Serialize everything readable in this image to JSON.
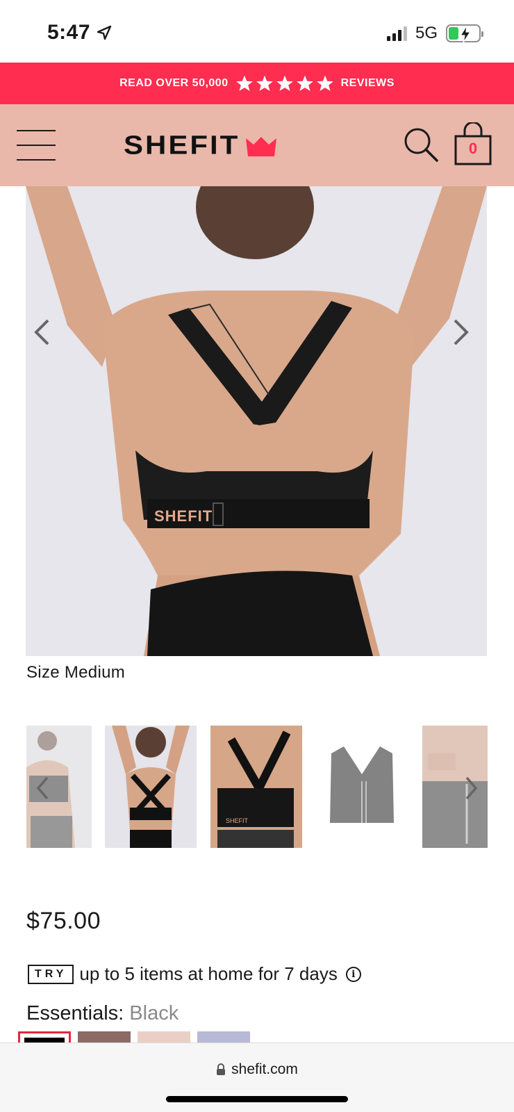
{
  "status_bar": {
    "time": "5:47",
    "network": "5G"
  },
  "promo": {
    "text_before": "READ OVER 50,000",
    "text_after": "REVIEWS",
    "star_count": 5,
    "color": "#ff2d4f"
  },
  "header": {
    "brand": "SHEFIT",
    "background": "#e9b8ab",
    "cart_count": "0"
  },
  "product": {
    "image_caption": "Size Medium",
    "price": "$75.00",
    "try_badge": "TRY",
    "try_text": "up to 5 items at home for 7 days",
    "color_label": "Essentials:",
    "color_value": "Black",
    "swatches": [
      "#000000",
      "#8a6b66",
      "#e9d0c6",
      "#b8b9d6"
    ]
  },
  "thumbnails": [
    {
      "name": "front-view"
    },
    {
      "name": "back-arms-up"
    },
    {
      "name": "back-cross-straps"
    },
    {
      "name": "bra-flat"
    },
    {
      "name": "zip-front"
    }
  ],
  "browser": {
    "url": "shefit.com"
  }
}
